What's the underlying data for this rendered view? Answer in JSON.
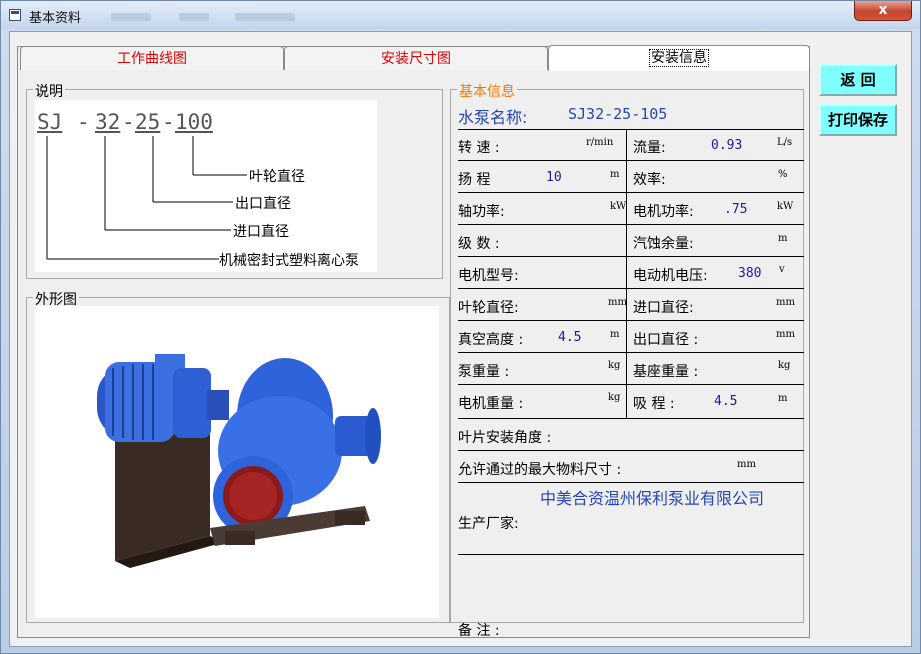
{
  "window": {
    "title": "基本资料",
    "close_label": "x"
  },
  "tabs": [
    {
      "label": "工作曲线图"
    },
    {
      "label": "安装尺寸图"
    },
    {
      "label": "安装信息"
    }
  ],
  "description_group": {
    "legend": "说明",
    "code": {
      "sj": "SJ",
      "dash": "-",
      "n1": "32",
      "n2": "25",
      "n3": "100",
      "sep": "-"
    },
    "labels": [
      "叶轮直径",
      "出口直径",
      "进口直径",
      "机械密封式塑料离心泵"
    ]
  },
  "appearance_group": {
    "legend": "外形图"
  },
  "basic_info": {
    "legend": "基本信息",
    "pump_name_label": "水泵名称:",
    "pump_name_value": "SJ32-25-105",
    "rows": [
      {
        "l_label": "转 速 :",
        "l_value": "",
        "l_unit": "r/min",
        "r_label": "流量:",
        "r_value": "0.93",
        "r_unit": "L/s"
      },
      {
        "l_label": "扬 程",
        "l_value": "10",
        "l_unit": "m",
        "r_label": "效率:",
        "r_value": "",
        "r_unit": "%"
      },
      {
        "l_label": "轴功率:",
        "l_value": "",
        "l_unit": "kW",
        "r_label": "电机功率:",
        "r_value": ".75",
        "r_unit": "kW"
      },
      {
        "l_label": "级 数 :",
        "l_value": "",
        "l_unit": "",
        "r_label": "汽蚀余量:",
        "r_value": "",
        "r_unit": "m"
      },
      {
        "l_label": "电机型号:",
        "l_value": "",
        "l_unit": "",
        "r_label": "电动机电压:",
        "r_value": "380",
        "r_unit": "v"
      },
      {
        "l_label": "叶轮直径:",
        "l_value": "",
        "l_unit": "mm",
        "r_label": "进口直径:",
        "r_value": "",
        "r_unit": "mm"
      },
      {
        "l_label": "真空高度 :",
        "l_value": "4.5",
        "l_unit": "m",
        "r_label": "出口直径 :",
        "r_value": "",
        "r_unit": "mm"
      },
      {
        "l_label": "泵重量 :",
        "l_value": "",
        "l_unit": "kg",
        "r_label": "基座重量 :",
        "r_value": "",
        "r_unit": "kg"
      },
      {
        "l_label": "电机重量 :",
        "l_value": "",
        "l_unit": "kg",
        "r_label": "吸 程 :",
        "r_value": "4.5",
        "r_unit": "m"
      }
    ],
    "blade_angle_label": "叶片安装角度 :",
    "max_material_label": "允许通过的最大物料尺寸 :",
    "max_material_unit": "mm",
    "manufacturer_label": "生产厂家:",
    "manufacturer_value": "中美合资温州保利泵业有限公司",
    "remarks_label": "备 注 :"
  },
  "buttons": {
    "back": "返 回",
    "print_save": "打印保存"
  },
  "colors": {
    "tab_text": "#e00000",
    "value_text": "#1a1aa0",
    "accent_legend": "#f07800",
    "button_bg": "#80ffff"
  }
}
